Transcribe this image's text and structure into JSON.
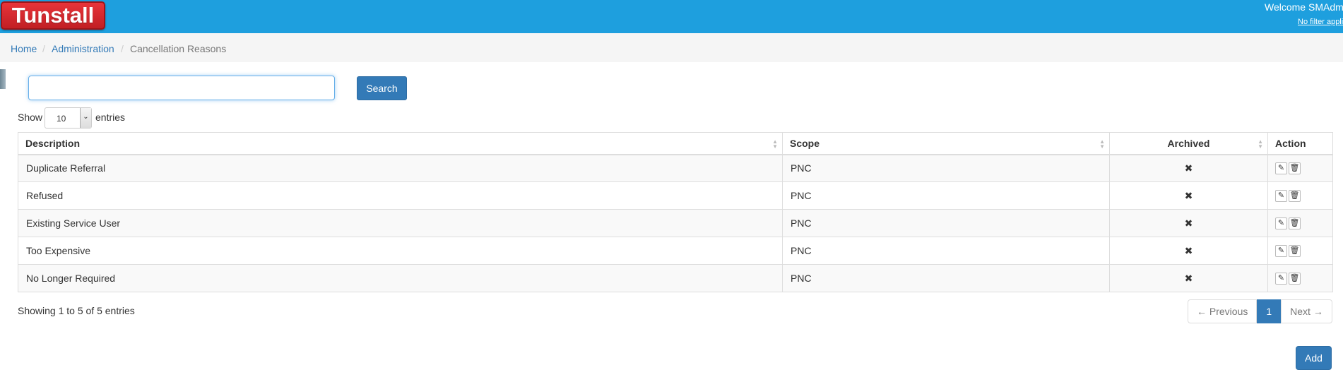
{
  "header": {
    "logo_text": "Tunstall",
    "welcome": "Welcome SMAdm",
    "filter_link": "No filter appli",
    "bar_color": "#1e9fde"
  },
  "breadcrumb": {
    "home": "Home",
    "separator": "/",
    "administration": "Administration",
    "current": "Cancellation Reasons"
  },
  "search": {
    "value": "",
    "button_label": "Search"
  },
  "length_menu": {
    "prefix": "Show",
    "selected": "10",
    "suffix": "entries"
  },
  "table": {
    "columns": [
      "Description",
      "Scope",
      "Archived",
      "Action"
    ],
    "rows": [
      {
        "description": "Duplicate Referral",
        "scope": "PNC",
        "archived": "✖"
      },
      {
        "description": "Refused",
        "scope": "PNC",
        "archived": "✖"
      },
      {
        "description": "Existing Service User",
        "scope": "PNC",
        "archived": "✖"
      },
      {
        "description": "Too Expensive",
        "scope": "PNC",
        "archived": "✖"
      },
      {
        "description": "No Longer Required",
        "scope": "PNC",
        "archived": "✖"
      }
    ],
    "edit_icon": "pencil-icon",
    "delete_icon": "trash-icon"
  },
  "footer": {
    "info": "Showing 1 to 5 of 5 entries",
    "previous": "← Previous",
    "page": "1",
    "next": "Next →",
    "add_label": "Add"
  }
}
